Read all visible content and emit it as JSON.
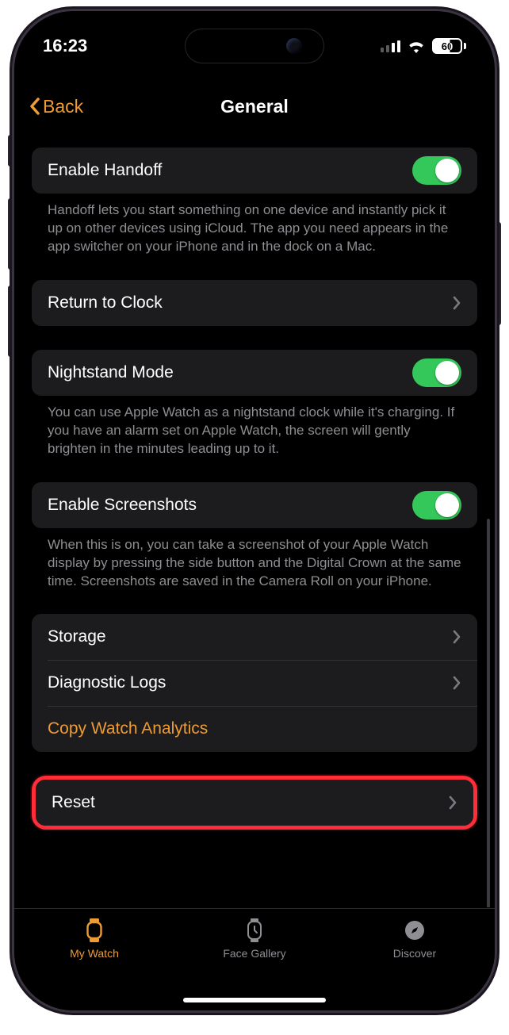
{
  "status": {
    "time": "16:23",
    "battery": "60"
  },
  "nav": {
    "back": "Back",
    "title": "General"
  },
  "handoff": {
    "label": "Enable Handoff",
    "on": true,
    "desc": "Handoff lets you start something on one device and instantly pick it up on other devices using iCloud. The app you need appears in the app switcher on your iPhone and in the dock on a Mac."
  },
  "return_clock": {
    "label": "Return to Clock"
  },
  "nightstand": {
    "label": "Nightstand Mode",
    "on": true,
    "desc": "You can use Apple Watch as a nightstand clock while it's charging. If you have an alarm set on Apple Watch, the screen will gently brighten in the minutes leading up to it."
  },
  "screenshots": {
    "label": "Enable Screenshots",
    "on": true,
    "desc": "When this is on, you can take a screenshot of your Apple Watch display by pressing the side button and the Digital Crown at the same time. Screenshots are saved in the Camera Roll on your iPhone."
  },
  "storage": {
    "label": "Storage"
  },
  "diag": {
    "label": "Diagnostic Logs"
  },
  "copy_analytics": {
    "label": "Copy Watch Analytics"
  },
  "reset": {
    "label": "Reset"
  },
  "tabs": {
    "watch": "My Watch",
    "gallery": "Face Gallery",
    "discover": "Discover"
  }
}
